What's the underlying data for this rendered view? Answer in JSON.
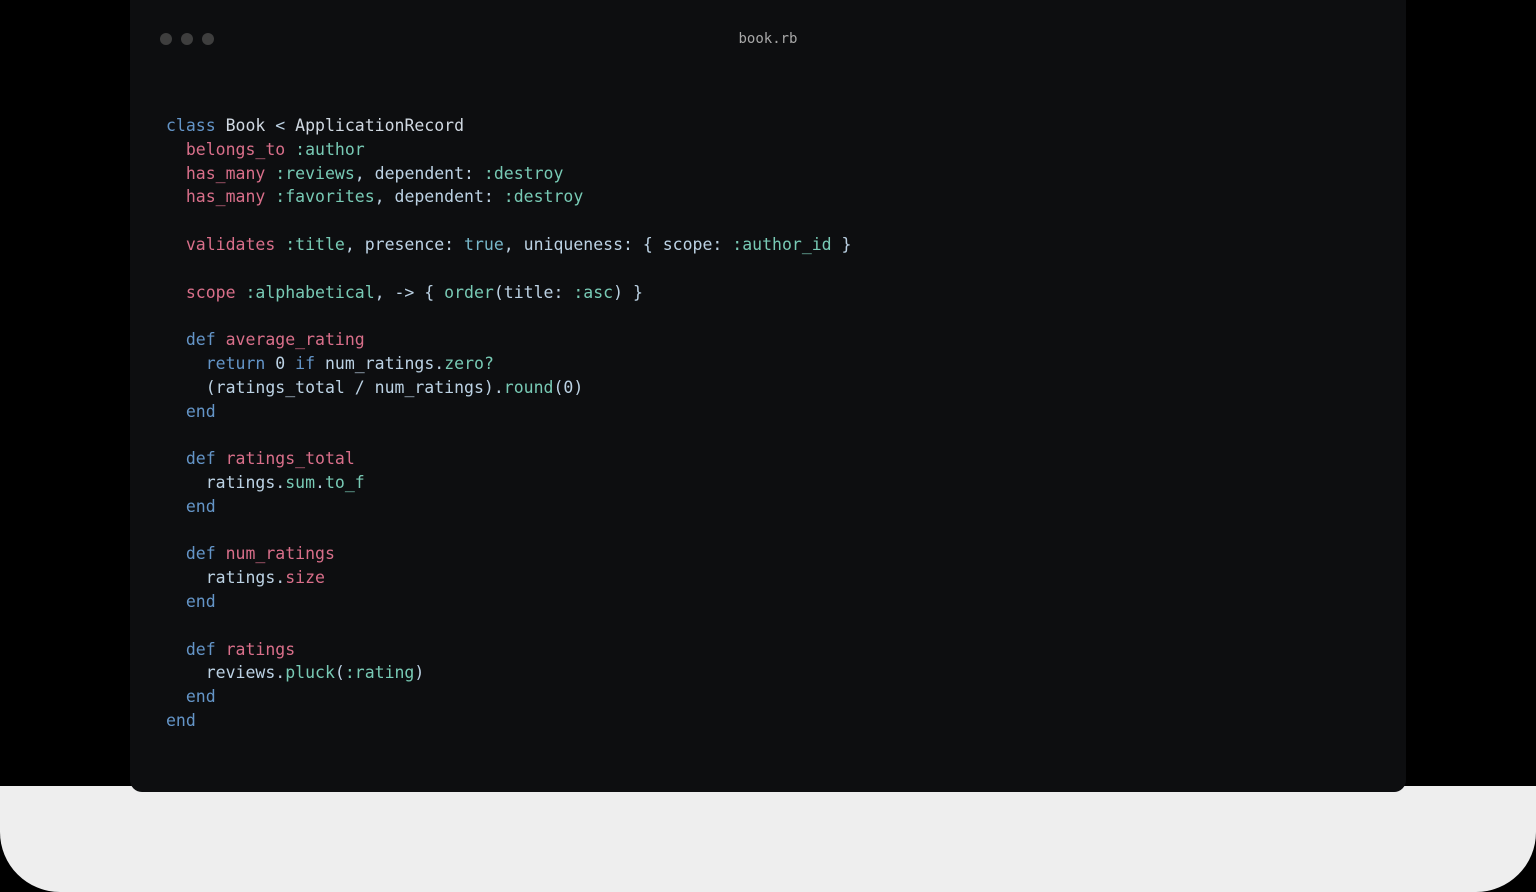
{
  "colors": {
    "bg": "#000000",
    "editor_bg": "#0d0e10",
    "keyword": "#6495c8",
    "macro": "#d96f8a",
    "symbol": "#78cab5",
    "default": "#bcd2e4",
    "chrome": "#eeeeee"
  },
  "titlebar": {
    "filename": "book.rb"
  },
  "code": {
    "language": "ruby",
    "lines": [
      [
        {
          "c": "kw",
          "t": "class"
        },
        {
          "t": " "
        },
        {
          "c": "cls",
          "t": "Book"
        },
        {
          "t": " "
        },
        {
          "c": "op",
          "t": "<"
        },
        {
          "t": " "
        },
        {
          "c": "inh",
          "t": "ApplicationRecord"
        }
      ],
      [
        {
          "t": "  "
        },
        {
          "c": "mac",
          "t": "belongs_to"
        },
        {
          "t": " "
        },
        {
          "c": "sym",
          "t": ":author"
        }
      ],
      [
        {
          "t": "  "
        },
        {
          "c": "mac",
          "t": "has_many"
        },
        {
          "t": " "
        },
        {
          "c": "sym",
          "t": ":reviews"
        },
        {
          "c": "punc",
          "t": ", dependent: "
        },
        {
          "c": "sym",
          "t": ":destroy"
        }
      ],
      [
        {
          "t": "  "
        },
        {
          "c": "mac",
          "t": "has_many"
        },
        {
          "t": " "
        },
        {
          "c": "sym",
          "t": ":favorites"
        },
        {
          "c": "punc",
          "t": ", dependent: "
        },
        {
          "c": "sym",
          "t": ":destroy"
        }
      ],
      [
        {
          "t": ""
        }
      ],
      [
        {
          "t": "  "
        },
        {
          "c": "mac",
          "t": "validates"
        },
        {
          "t": " "
        },
        {
          "c": "sym",
          "t": ":title"
        },
        {
          "c": "punc",
          "t": ", presence: "
        },
        {
          "c": "lit",
          "t": "true"
        },
        {
          "c": "punc",
          "t": ", uniqueness: { scope: "
        },
        {
          "c": "sym",
          "t": ":author_id"
        },
        {
          "c": "punc",
          "t": " }"
        }
      ],
      [
        {
          "t": ""
        }
      ],
      [
        {
          "t": "  "
        },
        {
          "c": "mac",
          "t": "scope"
        },
        {
          "t": " "
        },
        {
          "c": "sym",
          "t": ":alphabetical"
        },
        {
          "c": "punc",
          "t": ", -> { "
        },
        {
          "c": "fn",
          "t": "order"
        },
        {
          "c": "punc",
          "t": "(title: "
        },
        {
          "c": "sym",
          "t": ":asc"
        },
        {
          "c": "punc",
          "t": ") }"
        }
      ],
      [
        {
          "t": ""
        }
      ],
      [
        {
          "t": "  "
        },
        {
          "c": "kw",
          "t": "def"
        },
        {
          "t": " "
        },
        {
          "c": "mac",
          "t": "average_rating"
        }
      ],
      [
        {
          "t": "    "
        },
        {
          "c": "kw",
          "t": "return"
        },
        {
          "t": " "
        },
        {
          "c": "num",
          "t": "0"
        },
        {
          "t": " "
        },
        {
          "c": "kw",
          "t": "if"
        },
        {
          "t": " num_ratings"
        },
        {
          "c": "punc",
          "t": "."
        },
        {
          "c": "fn",
          "t": "zero?"
        }
      ],
      [
        {
          "t": "    "
        },
        {
          "c": "punc",
          "t": "(ratings_total "
        },
        {
          "c": "op",
          "t": "/"
        },
        {
          "c": "punc",
          "t": " num_ratings)"
        },
        {
          "c": "punc",
          "t": "."
        },
        {
          "c": "fn",
          "t": "round"
        },
        {
          "c": "punc",
          "t": "("
        },
        {
          "c": "num",
          "t": "0"
        },
        {
          "c": "punc",
          "t": ")"
        }
      ],
      [
        {
          "t": "  "
        },
        {
          "c": "kw",
          "t": "end"
        }
      ],
      [
        {
          "t": ""
        }
      ],
      [
        {
          "t": "  "
        },
        {
          "c": "kw",
          "t": "def"
        },
        {
          "t": " "
        },
        {
          "c": "mac",
          "t": "ratings_total"
        }
      ],
      [
        {
          "t": "    ratings"
        },
        {
          "c": "punc",
          "t": "."
        },
        {
          "c": "fn",
          "t": "sum"
        },
        {
          "c": "punc",
          "t": "."
        },
        {
          "c": "fn",
          "t": "to_f"
        }
      ],
      [
        {
          "t": "  "
        },
        {
          "c": "kw",
          "t": "end"
        }
      ],
      [
        {
          "t": ""
        }
      ],
      [
        {
          "t": "  "
        },
        {
          "c": "kw",
          "t": "def"
        },
        {
          "t": " "
        },
        {
          "c": "mac",
          "t": "num_ratings"
        }
      ],
      [
        {
          "t": "    ratings"
        },
        {
          "c": "punc",
          "t": "."
        },
        {
          "c": "mac",
          "t": "size"
        }
      ],
      [
        {
          "t": "  "
        },
        {
          "c": "kw",
          "t": "end"
        }
      ],
      [
        {
          "t": ""
        }
      ],
      [
        {
          "t": "  "
        },
        {
          "c": "kw",
          "t": "def"
        },
        {
          "t": " "
        },
        {
          "c": "mac",
          "t": "ratings"
        }
      ],
      [
        {
          "t": "    reviews"
        },
        {
          "c": "punc",
          "t": "."
        },
        {
          "c": "fn",
          "t": "pluck"
        },
        {
          "c": "punc",
          "t": "("
        },
        {
          "c": "sym",
          "t": ":rating"
        },
        {
          "c": "punc",
          "t": ")"
        }
      ],
      [
        {
          "t": "  "
        },
        {
          "c": "kw",
          "t": "end"
        }
      ],
      [
        {
          "c": "kw",
          "t": "end"
        }
      ]
    ]
  }
}
